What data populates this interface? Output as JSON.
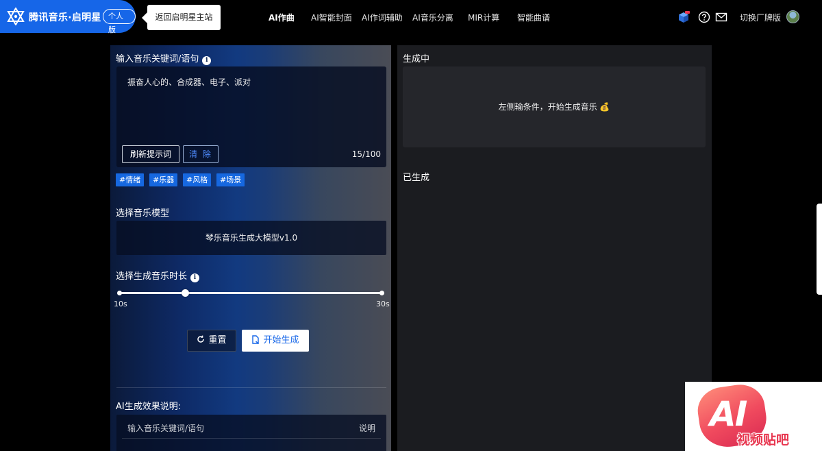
{
  "header": {
    "brand_name": "腾讯音乐·启明星",
    "edition": "个人版",
    "back_link": "返回启明星主站",
    "nav": [
      {
        "label": "AI作曲",
        "active": true
      },
      {
        "label": "AI智能封面"
      },
      {
        "label": "AI作词辅助"
      },
      {
        "label": "AI音乐分离"
      },
      {
        "label": "MIR计算"
      },
      {
        "label": "智能曲谱"
      }
    ],
    "icons": [
      "cube-icon",
      "help-icon",
      "mail-icon"
    ],
    "switch_label": "切换厂牌版"
  },
  "left": {
    "prompt_label": "输入音乐关键词/语句",
    "prompt_value": "振奋人心的、合成器、电子、派对",
    "refresh_button": "刷新提示词",
    "clear_button": "清 除",
    "counter": "15/100",
    "tags": [
      "#情绪",
      "#乐器",
      "#风格",
      "#场景"
    ],
    "model_label": "选择音乐模型",
    "model_value": "琴乐音乐生成大模型v1.0",
    "duration_label": "选择生成音乐时长",
    "duration_min": "10s",
    "duration_max": "30s",
    "duration_value_fraction": 0.25,
    "reset_button": "重置",
    "start_button": "开始生成",
    "explain_label": "AI生成效果说明:",
    "explain_col1": "输入音乐关键词/语句",
    "explain_col2": "说明"
  },
  "right": {
    "generating_label": "生成中",
    "empty_hint": "左侧输条件，开始生成音乐 💰",
    "generated_label": "已生成"
  },
  "watermark": {
    "ai": "AI",
    "text": "视频贴吧"
  },
  "colors": {
    "brand": "#1666e8",
    "tag": "#1668e0",
    "accent_text": "#4f8cff"
  }
}
